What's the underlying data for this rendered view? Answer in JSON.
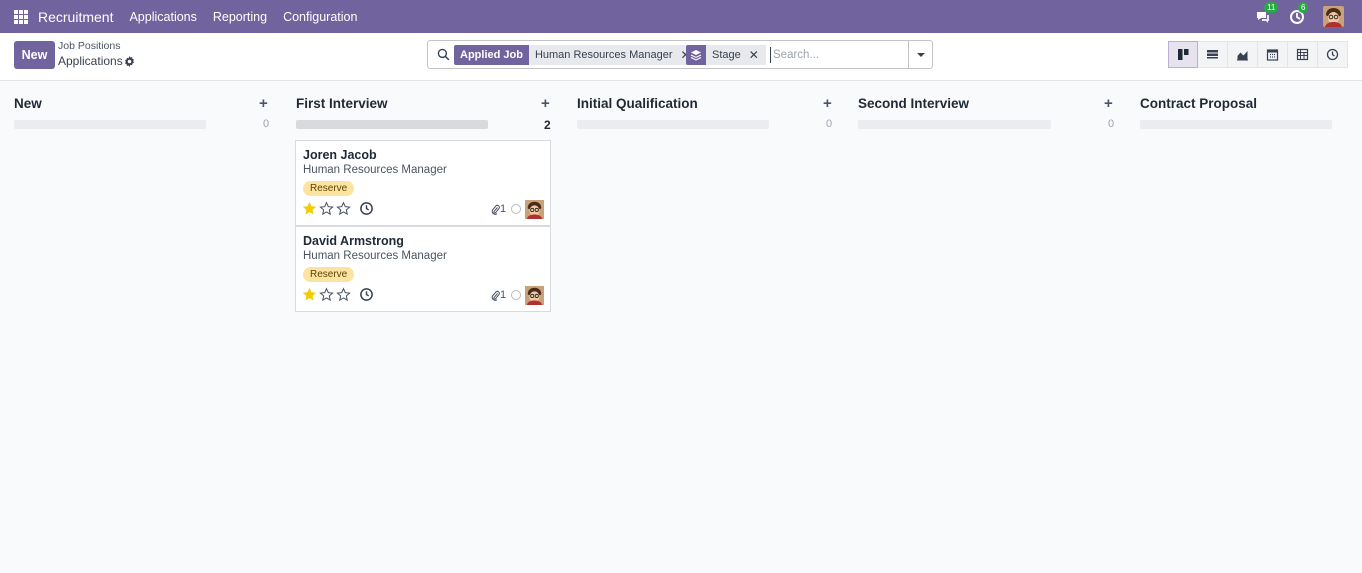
{
  "nav": {
    "app_name": "Recruitment",
    "menu": [
      "Applications",
      "Reporting",
      "Configuration"
    ],
    "messages_count": "11",
    "activities_count": "6",
    "apps_icon": "grid-icon",
    "accent": "#71639e"
  },
  "control": {
    "new_label": "New",
    "breadcrumb_parent": "Job Positions",
    "breadcrumb_current": "Applications",
    "search": {
      "facet1_label": "Applied Job",
      "facet1_value": "Human Resources Manager",
      "facet2_value": "Stage",
      "placeholder": "Search..."
    },
    "views": [
      "kanban-view-icon",
      "list-view-icon",
      "graph-view-icon",
      "calendar-view-icon",
      "pivot-view-icon",
      "activity-view-icon"
    ]
  },
  "columns": [
    {
      "title": "New",
      "count": "0"
    },
    {
      "title": "First Interview",
      "count": "2"
    },
    {
      "title": "Initial Qualification",
      "count": "0"
    },
    {
      "title": "Second Interview",
      "count": "0"
    },
    {
      "title": "Contract Proposal",
      "count": ""
    }
  ],
  "cards": [
    {
      "name": "Joren Jacob",
      "job": "Human Resources Manager",
      "tag": "Reserve",
      "stars": 1,
      "attachments": "1"
    },
    {
      "name": "David Armstrong",
      "job": "Human Resources Manager",
      "tag": "Reserve",
      "stars": 1,
      "attachments": "1"
    }
  ]
}
